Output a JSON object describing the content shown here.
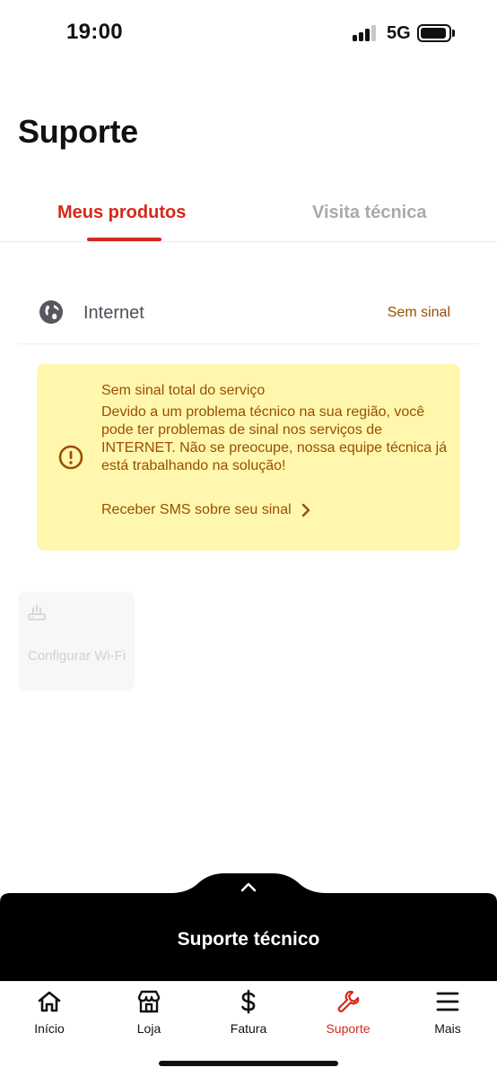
{
  "status_bar": {
    "time": "19:00",
    "network": "5G",
    "icons": [
      "signal-icon",
      "battery-icon"
    ]
  },
  "page": {
    "title": "Suporte"
  },
  "tabs": [
    {
      "label": "Meus produtos",
      "active": true
    },
    {
      "label": "Visita técnica",
      "active": false
    }
  ],
  "product": {
    "icon": "globe-icon",
    "name": "Internet",
    "status": "Sem sinal"
  },
  "alert": {
    "icon": "warning-circle-icon",
    "title": "Sem sinal total do serviço",
    "body": "Devido a um problema técnico na sua região, você pode ter problemas de sinal nos serviços de INTERNET. Não se preocupe, nossa equipe técnica já está trabalhando na solução!",
    "link_label": "Receber SMS sobre seu sinal",
    "background": "#fff7ad",
    "text_color": "#9a4e00"
  },
  "quick_actions": [
    {
      "icon": "router-icon",
      "label": "Configurar Wi-Fi",
      "disabled": true
    }
  ],
  "support_sheet": {
    "title": "Suporte técnico",
    "handle_icon": "chevron-up-icon"
  },
  "nav": {
    "active_color": "#d5281b",
    "items": [
      {
        "icon": "home-icon",
        "label": "Início",
        "active": false
      },
      {
        "icon": "store-icon",
        "label": "Loja",
        "active": false
      },
      {
        "icon": "dollar-icon",
        "label": "Fatura",
        "active": false
      },
      {
        "icon": "wrench-icon",
        "label": "Suporte",
        "active": true
      },
      {
        "icon": "menu-icon",
        "label": "Mais",
        "active": false
      }
    ]
  }
}
